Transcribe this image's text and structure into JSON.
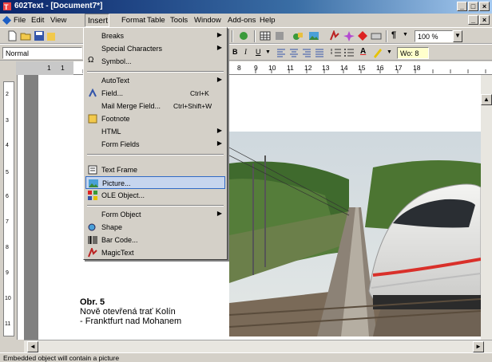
{
  "window": {
    "title": "602Text - [Document7*]"
  },
  "menubar": {
    "items": [
      "File",
      "Edit",
      "View",
      "Insert",
      "Format",
      "Table",
      "Tools",
      "Window",
      "Add-ons",
      "Help"
    ]
  },
  "toolbar": {
    "style": "Normal",
    "zoom": "100 %",
    "width_label": "Wo: 8"
  },
  "ruler": {
    "labels": [
      "1",
      "1",
      "8",
      "9",
      "10",
      "11",
      "12",
      "13",
      "14",
      "15",
      "16",
      "17",
      "18"
    ]
  },
  "vruler": {
    "labels": [
      "2",
      "3",
      "4",
      "5",
      "6",
      "7",
      "8",
      "9",
      "10",
      "11"
    ]
  },
  "insert_menu": {
    "items": [
      {
        "label": "Breaks",
        "submenu": true
      },
      {
        "label": "Special Characters",
        "submenu": true
      },
      {
        "label": "Symbol...",
        "icon": "omega-icon"
      },
      {
        "label": "AutoText",
        "submenu": true
      },
      {
        "label": "Field...",
        "shortcut": "Ctrl+K",
        "icon": "field-icon"
      },
      {
        "label": "Mail Merge Field...",
        "shortcut": "Ctrl+Shift+W"
      },
      {
        "label": "Footnote",
        "icon": "footnote-icon"
      },
      {
        "label": "HTML",
        "submenu": true
      },
      {
        "label": "Form Fields",
        "submenu": true
      },
      {
        "label": "Text Frame",
        "icon": "text-frame-icon"
      },
      {
        "label": "Picture...",
        "icon": "picture-icon",
        "highlighted": true
      },
      {
        "label": "OLE Object...",
        "icon": "ole-icon"
      },
      {
        "label": "Form Object",
        "submenu": true
      },
      {
        "label": "Shape",
        "icon": "shape-icon"
      },
      {
        "label": "Bar Code...",
        "icon": "barcode-icon"
      },
      {
        "label": "MagicText",
        "icon": "magictext-icon"
      }
    ]
  },
  "document": {
    "caption": [
      "Obr. 5",
      "Nově otevřená trať Kolín",
      " - Franktfurt nad Mohanem"
    ]
  },
  "statusbar": {
    "text": "Embedded object will contain a picture"
  },
  "colors": {
    "titlebar": "#0a246a",
    "menu_highlight": "#c6d5ee",
    "train_stripe": "#d9302a"
  }
}
